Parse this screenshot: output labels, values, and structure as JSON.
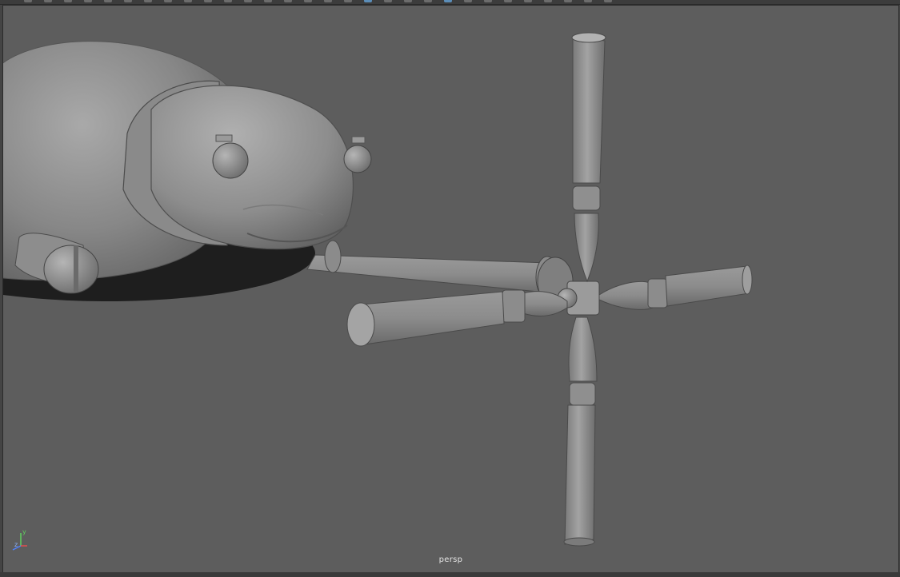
{
  "viewport": {
    "camera_label": "persp"
  },
  "axis_gizmo": {
    "y_label": "y",
    "z_label": "z",
    "x_color": "#e05050",
    "y_color": "#60d060",
    "z_color": "#5080ff"
  },
  "colors": {
    "viewport_bg": "#5d5d5d",
    "model_grey": "#8a8a8a",
    "selection_accent": "#5b8db8"
  },
  "toolbar": {
    "button_count": 30,
    "active_button_indices": [
      17,
      21,
      42
    ]
  }
}
